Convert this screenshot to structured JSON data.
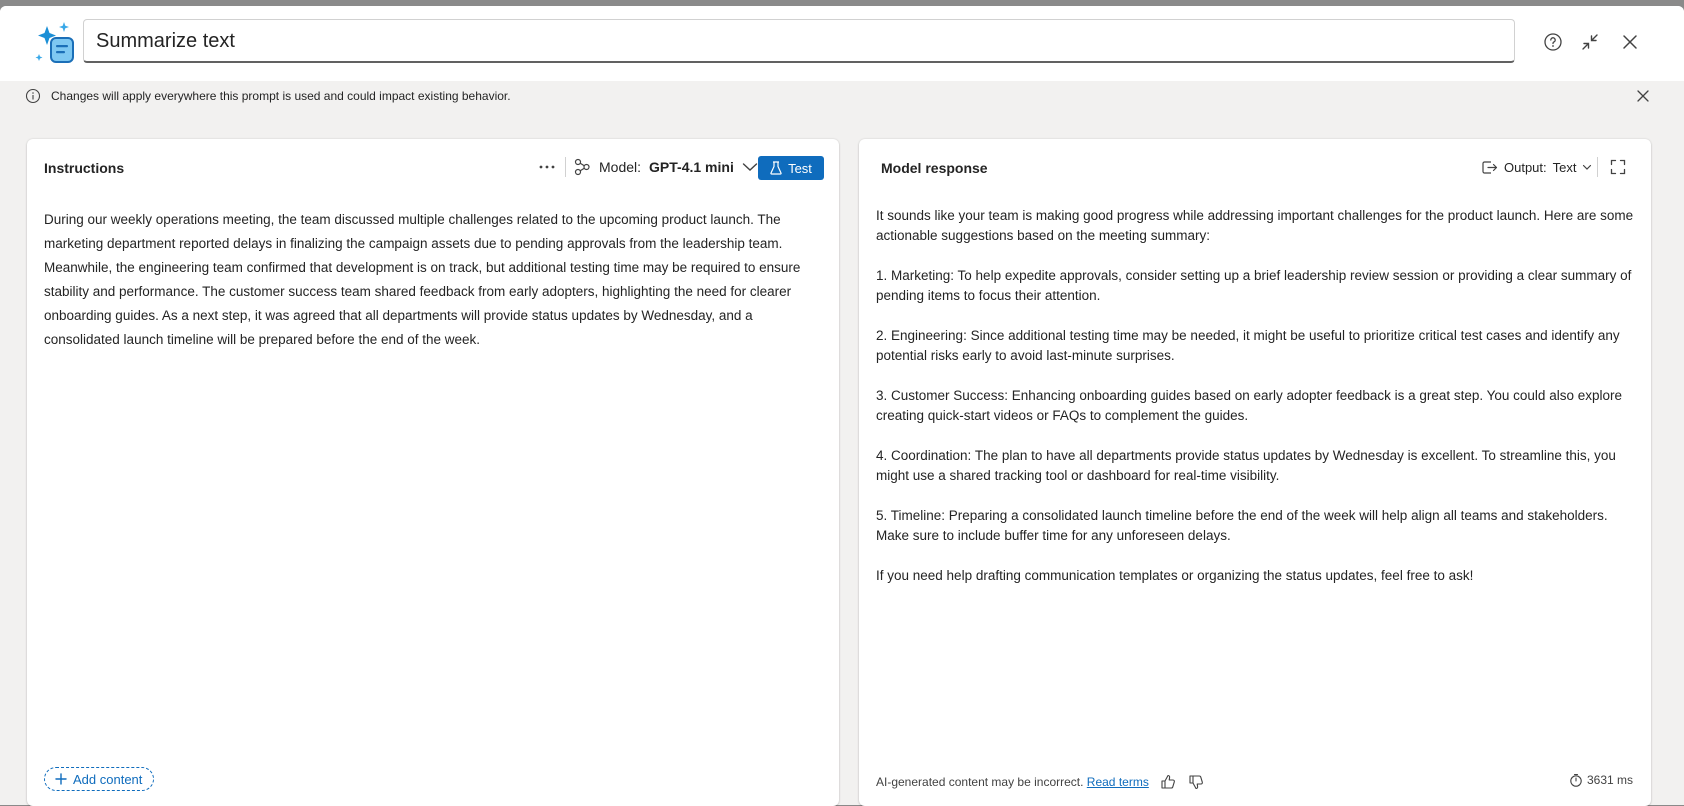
{
  "header": {
    "title_value": "Summarize text",
    "icons": [
      "prompt-sparkle-icon",
      "help-icon",
      "collapse-icon",
      "close-icon"
    ]
  },
  "banner": {
    "message": "Changes will apply everywhere this prompt is used and could impact existing behavior."
  },
  "instructions": {
    "title": "Instructions",
    "model_label": "Model:",
    "model_name": "GPT-4.1 mini",
    "test_label": "Test",
    "body": "During our weekly operations meeting, the team discussed multiple challenges related to the upcoming product launch. The marketing department reported delays in finalizing the campaign assets due to pending approvals from the leadership team. Meanwhile, the engineering team confirmed that development is on track, but additional testing time may be required to ensure stability and performance. The customer success team shared feedback from early adopters, highlighting the need for clearer onboarding guides. As a next step, it was agreed that all departments will provide status updates by Wednesday, and a consolidated launch timeline will be prepared before the end of the week.",
    "add_content_label": "Add content"
  },
  "response": {
    "title": "Model response",
    "output_label": "Output:",
    "output_value": "Text",
    "paragraphs": [
      "It sounds like your team is making good progress while addressing important challenges for the product launch. Here are some actionable suggestions based on the meeting summary:",
      "1. Marketing: To help expedite approvals, consider setting up a brief leadership review session or providing a clear summary of pending items to focus their attention.",
      "2. Engineering: Since additional testing time may be needed, it might be useful to prioritize critical test cases and identify any potential risks early to avoid last-minute surprises.",
      "3. Customer Success: Enhancing onboarding guides based on early adopter feedback is a great step. You could also explore creating quick-start videos or FAQs to complement the guides.",
      "4. Coordination: The plan to have all departments provide status updates by Wednesday is excellent. To streamline this, you might use a shared tracking tool or dashboard for real-time visibility.",
      "5. Timeline: Preparing a consolidated launch timeline before the end of the week will help align all teams and stakeholders. Make sure to include buffer time for any unforeseen delays.",
      "If you need help drafting communication templates or organizing the status updates, feel free to ask!"
    ],
    "disclaimer": "AI-generated content may be incorrect.",
    "read_terms": "Read terms",
    "latency": "3631 ms"
  },
  "colors": {
    "accent": "#0f6cbd",
    "banner_bg": "#f2f1f0"
  }
}
